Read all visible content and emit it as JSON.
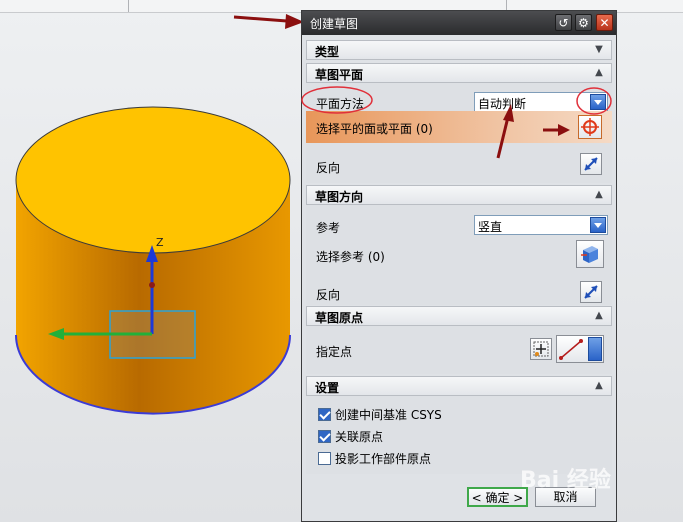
{
  "dialog": {
    "title": "创建草图",
    "sections": {
      "type": {
        "label": "类型"
      },
      "plane": {
        "label": "草图平面",
        "method_label": "平面方法",
        "method_value": "自动判断",
        "select_label": "选择平的面或平面 (0)",
        "reverse_label": "反向"
      },
      "orientation": {
        "label": "草图方向",
        "reference_label": "参考",
        "reference_value": "竖直",
        "select_ref_label": "选择参考 (0)",
        "reverse_label": "反向"
      },
      "origin": {
        "label": "草图原点",
        "point_label": "指定点"
      },
      "settings": {
        "label": "设置",
        "options": [
          {
            "label": "创建中间基准 CSYS",
            "checked": true
          },
          {
            "label": "关联原点",
            "checked": true
          },
          {
            "label": "投影工作部件原点",
            "checked": false
          }
        ]
      }
    },
    "ok_label": "< 确定 >",
    "cancel_label": "取消"
  },
  "scene": {
    "axis_label": "Z",
    "cylinder_color": "#f5a800",
    "top_color": "#ffc300"
  },
  "watermark": "Bai 经验"
}
